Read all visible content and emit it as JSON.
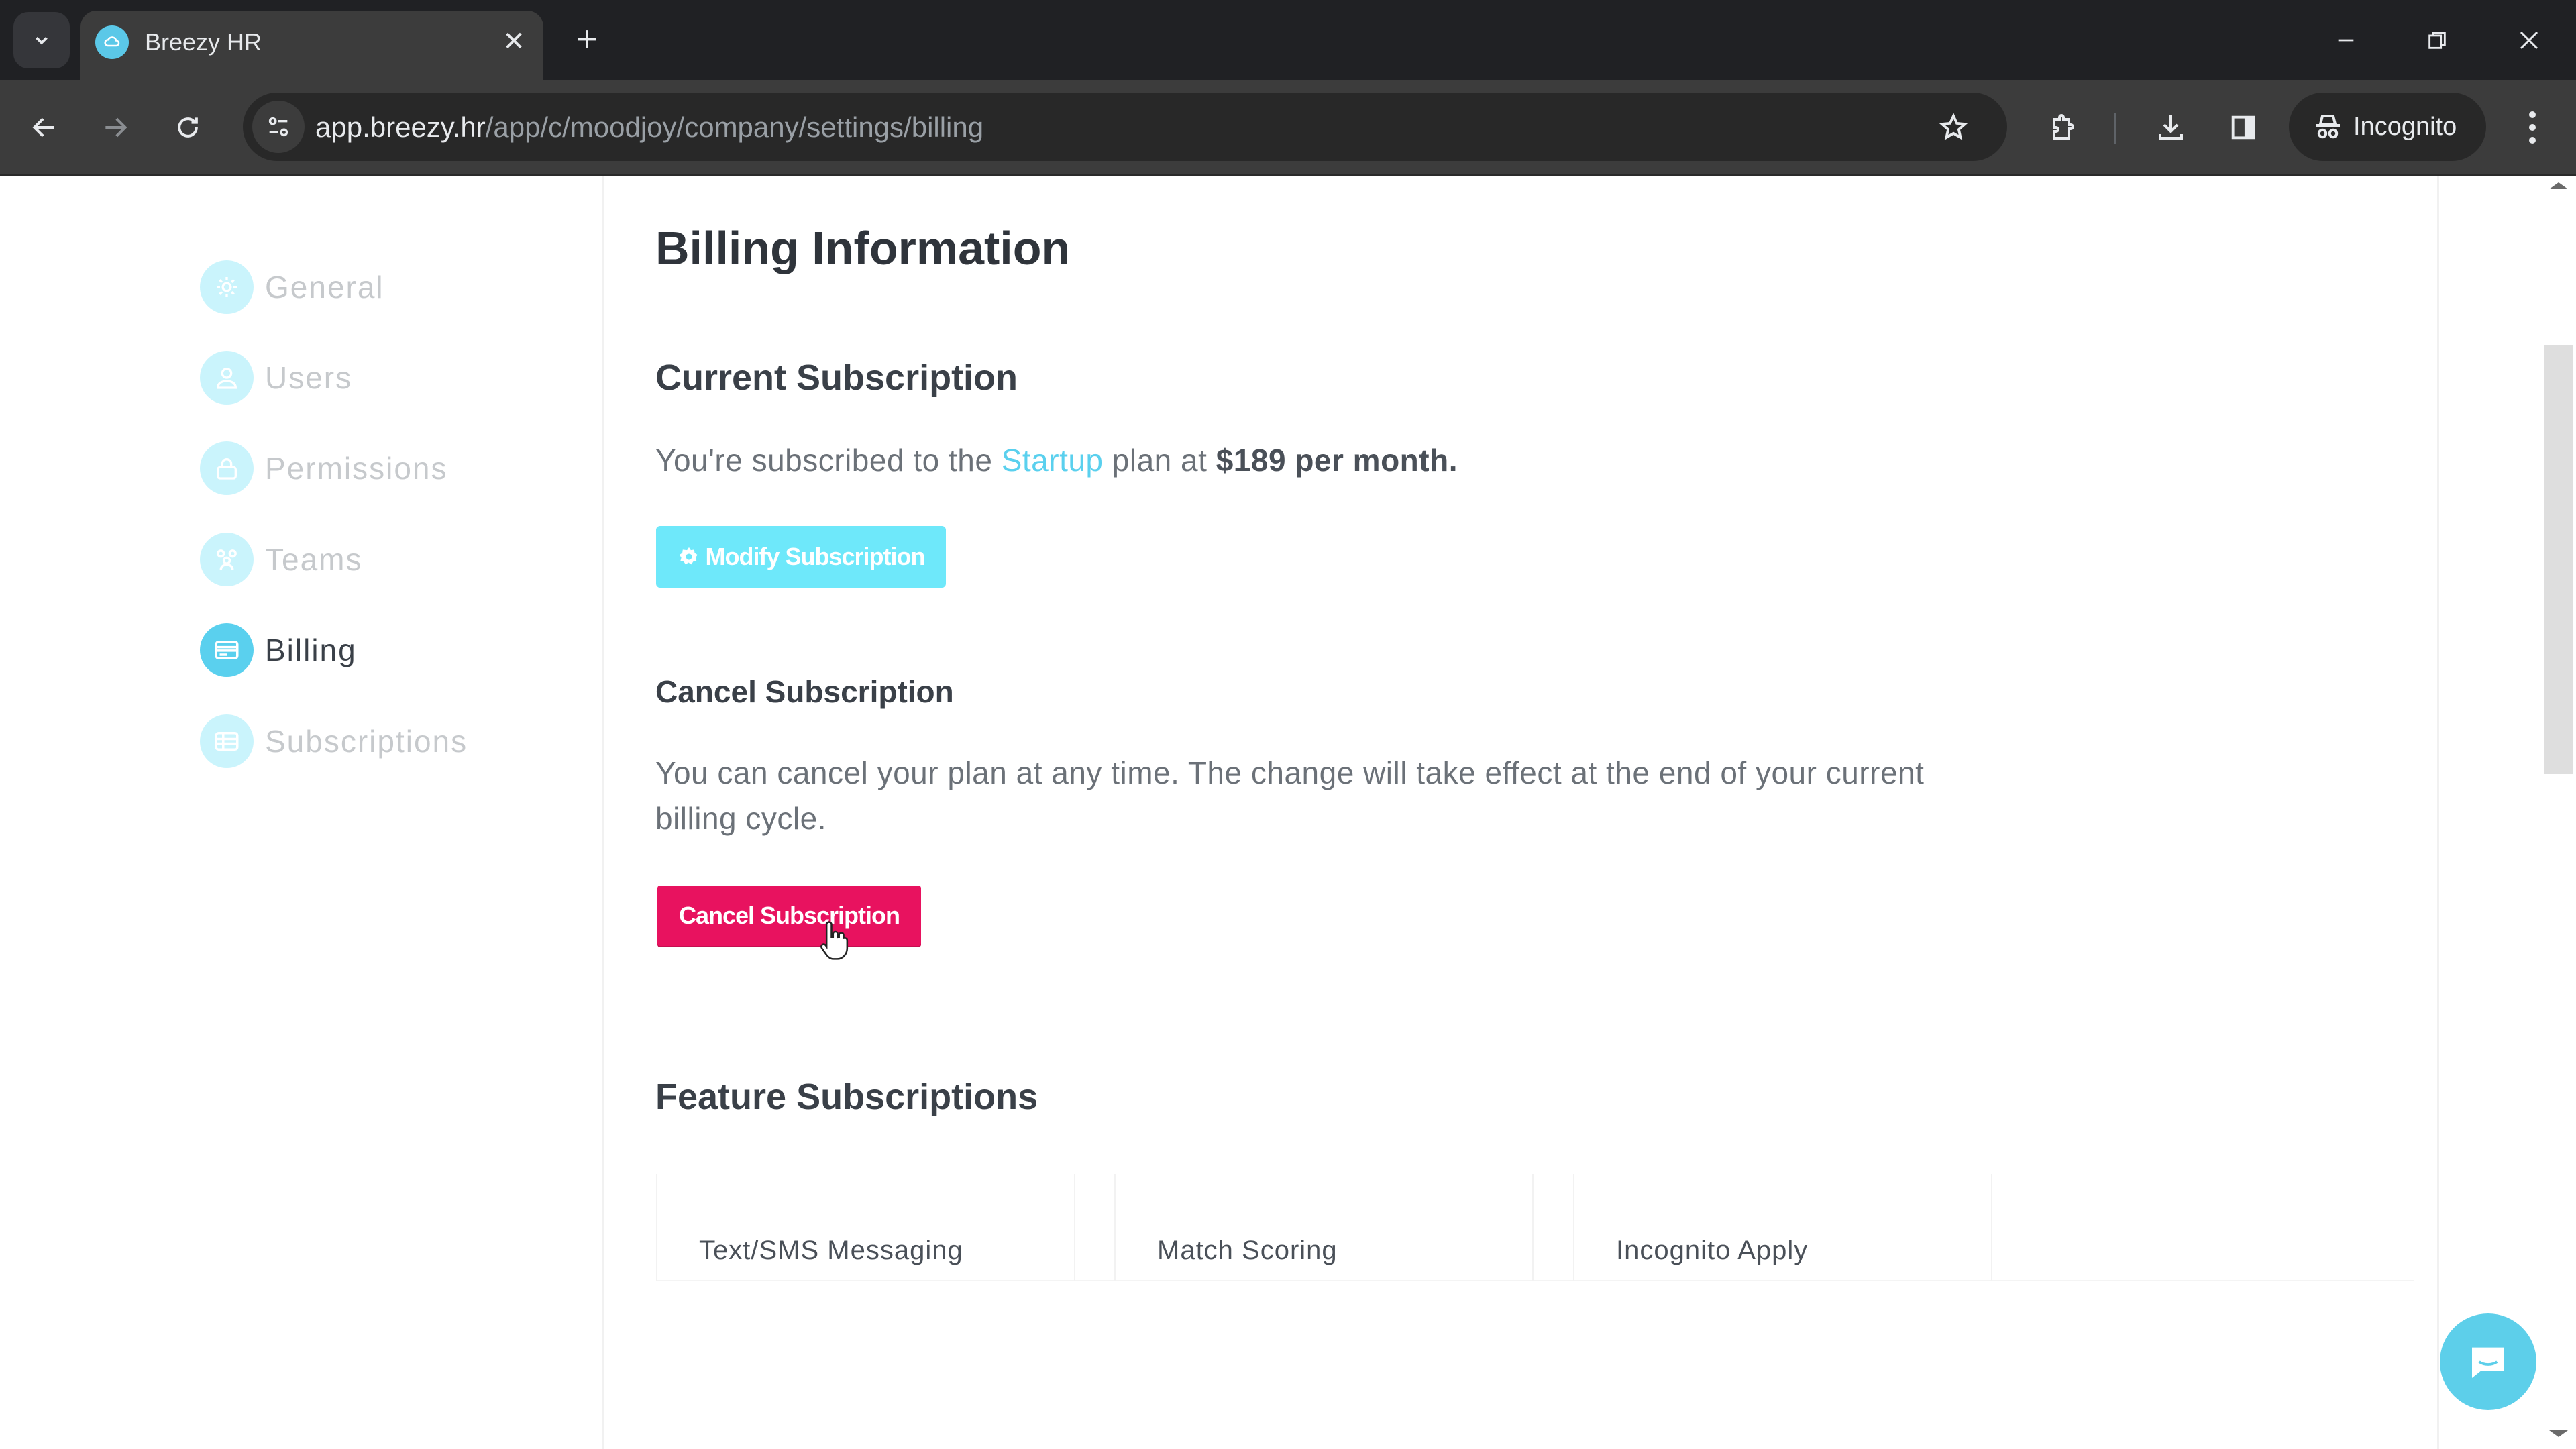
{
  "browser": {
    "tab_title": "Breezy HR",
    "url_host": "app.breezy.hr",
    "url_path": "/app/c/moodjoy/company/settings/billing",
    "incognito_label": "Incognito"
  },
  "sidebar": {
    "items": [
      {
        "label": "General",
        "icon": "gear-icon",
        "active": false
      },
      {
        "label": "Users",
        "icon": "user-icon",
        "active": false
      },
      {
        "label": "Permissions",
        "icon": "lock-icon",
        "active": false
      },
      {
        "label": "Teams",
        "icon": "team-icon",
        "active": false
      },
      {
        "label": "Billing",
        "icon": "credit-card-icon",
        "active": true
      },
      {
        "label": "Subscriptions",
        "icon": "list-icon",
        "active": false
      }
    ]
  },
  "main": {
    "title": "Billing Information",
    "current_subscription": {
      "heading": "Current Subscription",
      "text_prefix": "You're subscribed to the ",
      "plan_name": "Startup",
      "text_middle": " plan at ",
      "price_text": "$189 per month.",
      "modify_button": "Modify Subscription"
    },
    "cancel_subscription": {
      "heading": "Cancel Subscription",
      "description": "You can cancel your plan at any time. The change will take effect at the end of your current billing cycle.",
      "cancel_button": "Cancel Subscription"
    },
    "feature_subscriptions": {
      "heading": "Feature Subscriptions",
      "features": [
        {
          "label": "Text/SMS Messaging"
        },
        {
          "label": "Match Scoring"
        },
        {
          "label": "Incognito Apply"
        }
      ]
    }
  },
  "colors": {
    "accent": "#5ad0ee",
    "modify_button": "#6ee8fa",
    "danger": "#e8125f"
  }
}
